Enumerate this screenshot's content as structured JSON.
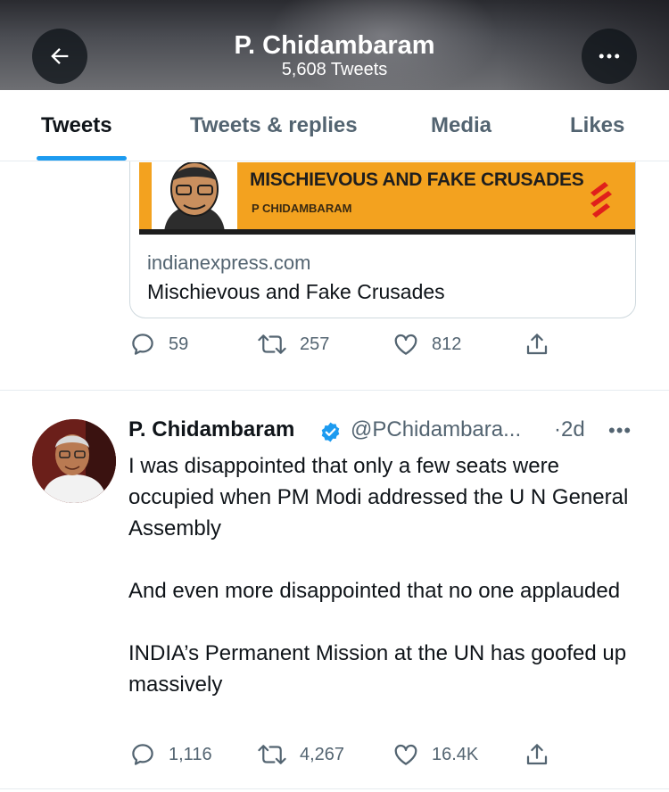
{
  "header": {
    "title": "P. Chidambaram",
    "subtitle": "5,608 Tweets",
    "back_icon": "arrow-left-icon",
    "more_icon": "ellipsis-icon"
  },
  "tabs": [
    {
      "label": "Tweets",
      "active": true
    },
    {
      "label": "Tweets & replies",
      "active": false
    },
    {
      "label": "Media",
      "active": false
    },
    {
      "label": "Likes",
      "active": false
    }
  ],
  "link_card": {
    "banner_headline": "MISCHIEVOUS AND FAKE CRUSADES",
    "banner_author": "P CHIDAMBARAM",
    "domain": "indianexpress.com",
    "title": "Mischievous and Fake Crusades"
  },
  "tweet1_actions": {
    "replies": "59",
    "retweets": "257",
    "likes": "812"
  },
  "tweet2": {
    "author": "P. Chidambaram",
    "handle": "@PChidambara...",
    "time": "·2d",
    "more": "•••",
    "paragraphs": [
      "I was disappointed that only a few seats were occupied when PM Modi addressed the U N General Assembly",
      "And even more disappointed that no one applauded",
      "INDIA’s Permanent Mission at the UN has goofed up massively"
    ],
    "actions": {
      "replies": "1,116",
      "retweets": "4,267",
      "likes": "16.4K"
    }
  },
  "colors": {
    "accent": "#1d9bf0",
    "muted": "#536471",
    "text": "#0f1419",
    "banner": "#f3a21f"
  }
}
